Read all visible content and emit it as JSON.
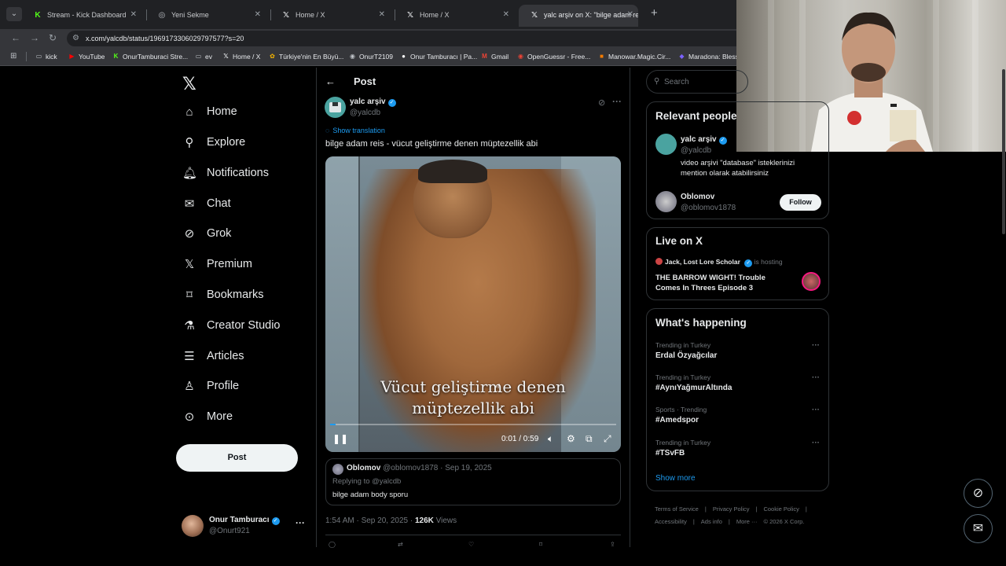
{
  "browser": {
    "tabs": [
      {
        "title": "Stream - Kick Dashboard",
        "icon": "kick-icon",
        "active": false
      },
      {
        "title": "Yeni Sekme",
        "icon": "chrome-icon",
        "active": false
      },
      {
        "title": "Home / X",
        "icon": "x-icon",
        "active": false
      },
      {
        "title": "Home / X",
        "icon": "x-icon",
        "active": false
      },
      {
        "title": "yalc arşiv on X: \"bilge adam reis",
        "icon": "x-icon",
        "active": true
      }
    ],
    "url": "x.com/yalcdb/status/1969173306029797577?s=20",
    "bookmarks": [
      {
        "label": "kick",
        "icon": "folder-icon"
      },
      {
        "label": "YouTube",
        "icon": "youtube-icon"
      },
      {
        "label": "OnurTamburaci Stre...",
        "icon": "kick-icon"
      },
      {
        "label": "ev",
        "icon": "folder-icon"
      },
      {
        "label": "Home / X",
        "icon": "x-icon"
      },
      {
        "label": "Türkiye'nin En Büyü...",
        "icon": "site-icon"
      },
      {
        "label": "OnurT2109",
        "icon": "site-icon"
      },
      {
        "label": "Onur Tamburacı | Pa...",
        "icon": "site-icon"
      },
      {
        "label": "Gmail",
        "icon": "gmail-icon"
      },
      {
        "label": "OpenGuessr - Free...",
        "icon": "site-icon"
      },
      {
        "label": "Manowar.Magic.Cir...",
        "icon": "site-icon"
      },
      {
        "label": "Maradona: Blesse...",
        "icon": "site-icon"
      }
    ]
  },
  "nav": {
    "items": [
      {
        "label": "Home",
        "icon": "home-icon"
      },
      {
        "label": "Explore",
        "icon": "search-icon"
      },
      {
        "label": "Notifications",
        "icon": "bell-icon"
      },
      {
        "label": "Chat",
        "icon": "mail-icon"
      },
      {
        "label": "Grok",
        "icon": "grok-icon"
      },
      {
        "label": "Premium",
        "icon": "x-icon"
      },
      {
        "label": "Bookmarks",
        "icon": "bookmark-icon"
      },
      {
        "label": "Creator Studio",
        "icon": "flask-icon"
      },
      {
        "label": "Articles",
        "icon": "article-icon"
      },
      {
        "label": "Profile",
        "icon": "person-icon"
      },
      {
        "label": "More",
        "icon": "more-circle-icon"
      }
    ],
    "post_button": "Post",
    "account": {
      "name": "Onur Tamburacı",
      "handle": "@Onurt921"
    }
  },
  "post": {
    "header_title": "Post",
    "author_name": "yalc arşiv",
    "author_handle": "@yalcdb",
    "show_translation": "Show translation",
    "text": "bilge adam reis - vücut geliştirme denen müptezellik abi",
    "video": {
      "caption_line1": "Vücut geliştirme denen",
      "caption_line2": "müptezellik abi",
      "time": "0:01 / 0:59",
      "progress": 0.02
    },
    "quoted_reply": {
      "name": "Oblomov",
      "handle_date": "@oblomov1878 · Sep 19, 2025",
      "replying_to": "Replying to @yalcdb",
      "text": "bilge adam body sporu"
    },
    "meta": {
      "time_date": "1:54 AM · Sep 20, 2025 ·",
      "views_count": "126K",
      "views_label": "Views"
    }
  },
  "sidebar": {
    "search_placeholder": "Search",
    "relevant_people": {
      "title": "Relevant people",
      "people": [
        {
          "name": "yalc arşiv",
          "handle": "@yalcdb",
          "bio": "video arşivi \"database\" isteklerinizi mention olarak atabilirsiniz"
        },
        {
          "name": "Oblomov",
          "handle": "@oblomov1878",
          "follow": "Follow"
        }
      ]
    },
    "live": {
      "title": "Live on X",
      "host": "Jack, Lost Lore Scholar",
      "host_suffix": "is hosting",
      "event": "THE BARROW WIGHT! Trouble Comes In Threes Episode 3"
    },
    "happening": {
      "title": "What's happening",
      "trends": [
        {
          "context": "Trending in Turkey",
          "name": "Erdal Özyağcılar"
        },
        {
          "context": "Trending in Turkey",
          "name": "#AynıYağmurAltında"
        },
        {
          "context": "Sports · Trending",
          "name": "#Amedspor"
        },
        {
          "context": "Trending in Turkey",
          "name": "#TSvFB"
        }
      ],
      "show_more": "Show more"
    },
    "footer": [
      "Terms of Service",
      "|",
      "Privacy Policy",
      "|",
      "Cookie Policy",
      "|",
      "Accessibility",
      "|",
      "Ads info",
      "|",
      "More ···",
      "© 2026 X Corp."
    ]
  },
  "colors": {
    "accent": "#1d9bf0",
    "background": "#000000",
    "text": "#e7e9ea",
    "muted": "#71767b",
    "border": "#2f3336"
  }
}
